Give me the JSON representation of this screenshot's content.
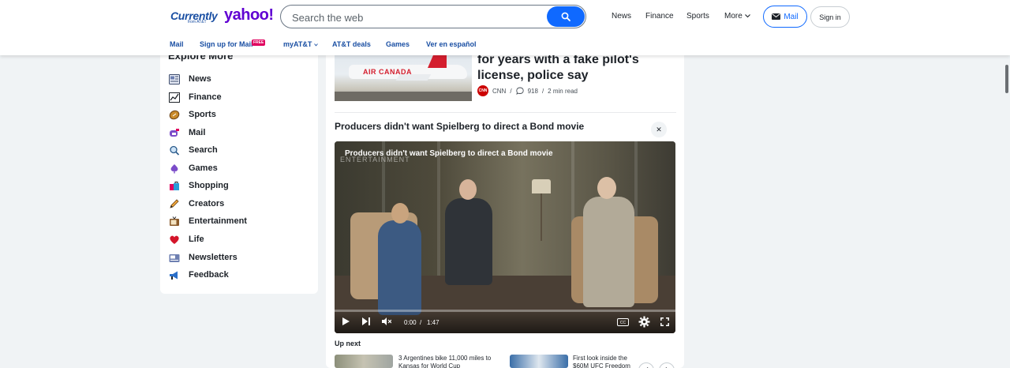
{
  "header": {
    "logo_currently": "Currently",
    "logo_currently_sub": "from AT&T",
    "logo_yahoo": "yahoo!",
    "search_placeholder": "Search the web",
    "nav": [
      "News",
      "Finance",
      "Sports",
      "More"
    ],
    "mail_label": "Mail",
    "signin_label": "Sign in"
  },
  "subnav": {
    "items": [
      "Mail",
      "Sign up for Mail",
      "myAT&T",
      "AT&T deals",
      "Games",
      "Ver en español"
    ],
    "free_badge": "FREE"
  },
  "sidebar": {
    "title": "Explore More",
    "items": [
      {
        "label": "News",
        "icon": "newspaper-icon"
      },
      {
        "label": "Finance",
        "icon": "chart-icon"
      },
      {
        "label": "Sports",
        "icon": "football-icon"
      },
      {
        "label": "Mail",
        "icon": "mailbox-icon"
      },
      {
        "label": "Search",
        "icon": "magnifier-icon"
      },
      {
        "label": "Games",
        "icon": "spade-icon"
      },
      {
        "label": "Shopping",
        "icon": "shopping-bag-icon"
      },
      {
        "label": "Creators",
        "icon": "pencil-icon"
      },
      {
        "label": "Entertainment",
        "icon": "tv-icon"
      },
      {
        "label": "Life",
        "icon": "heart-icon"
      },
      {
        "label": "Newsletters",
        "icon": "newsletter-icon"
      },
      {
        "label": "Feedback",
        "icon": "megaphone-icon"
      }
    ]
  },
  "story": {
    "image_text": "AIR CANADA",
    "title": "for years with a fake pilot's license, police say",
    "source": "CNN",
    "source_logo_text": "CNN",
    "comments": "918",
    "read_time": "2 min read"
  },
  "video": {
    "heading": "Producers didn't want Spielberg to direct a Bond movie",
    "caption": "Producers didn't want Spielberg to direct a Bond movie",
    "watermark": "ENTERTAINMENT",
    "current_time": "0:00",
    "separator": "/",
    "duration": "1:47",
    "progress": 0,
    "close_label": "✕"
  },
  "upnext": {
    "label": "Up next",
    "items": [
      {
        "text": "3 Argentines bike 11,000 miles to Kansas for World Cup"
      },
      {
        "text": "First look inside the $60M UFC Freedom"
      }
    ]
  }
}
